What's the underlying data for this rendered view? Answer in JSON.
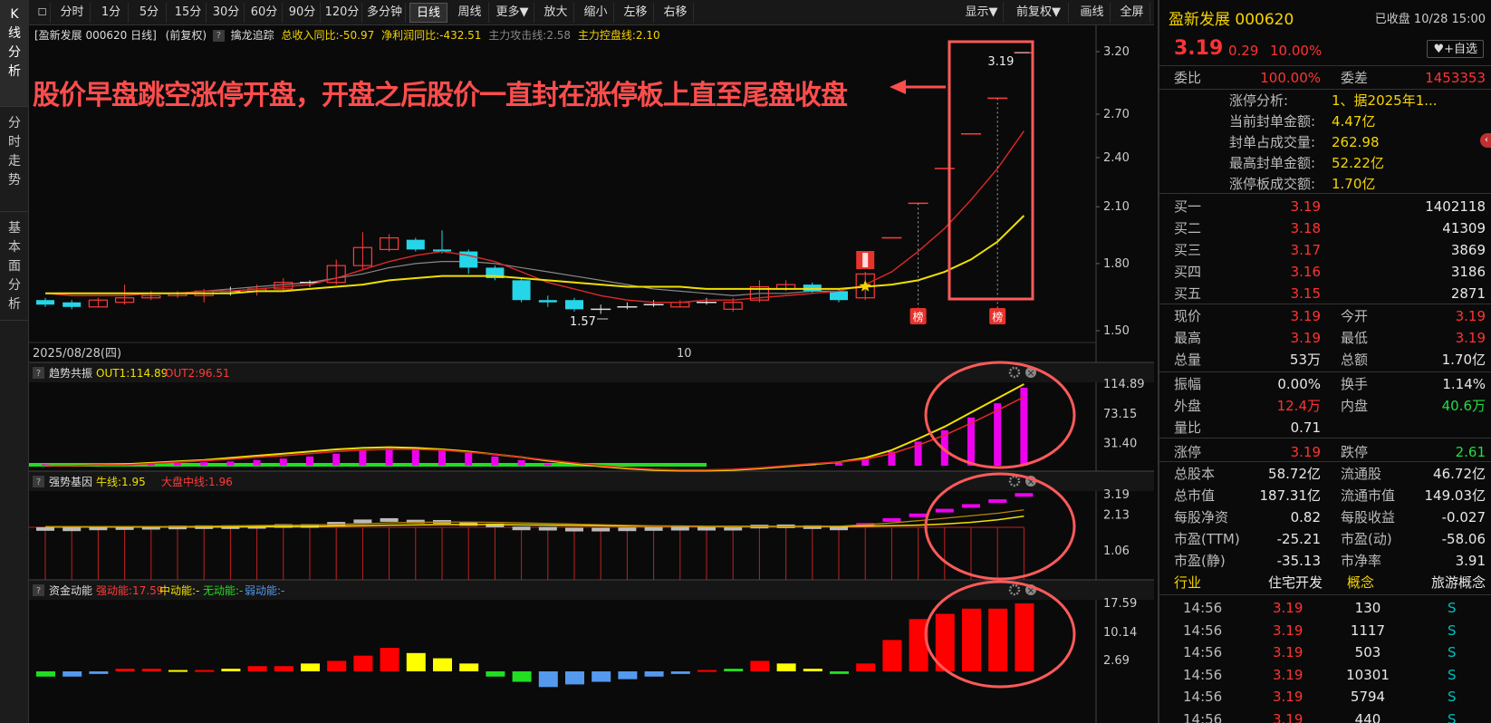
{
  "side_tabs": [
    "K线分析",
    "分时走势",
    "基本面分析"
  ],
  "toolbar": {
    "buttons": [
      "分时",
      "1分",
      "5分",
      "15分",
      "30分",
      "60分",
      "90分",
      "120分",
      "多分钟",
      "日线",
      "周线",
      "更多▼",
      "放大",
      "缩小",
      "左移",
      "右移"
    ],
    "active": "日线",
    "right_buttons": [
      "显示▼",
      "前复权▼",
      "画线",
      "全屏"
    ]
  },
  "infobar": {
    "stock": "[盈新发展 000620 日线]",
    "adjust": "(前复权)",
    "indicator": "擒龙追踪",
    "revenue": "总收入同比:-50.97",
    "profit": "净利润同比:-432.51",
    "attack": "主力攻击线:2.58",
    "control": "主力控盘线:2.10"
  },
  "annotation": {
    "text": "股价早盘跳空涨停开盘，开盘之后股价一直封在涨停板上直至尾盘收盘",
    "color": "#ff4d4d"
  },
  "price_chart": {
    "y_ticks": [
      "3.20",
      "2.70",
      "2.40",
      "2.10",
      "1.80",
      "1.50"
    ],
    "high_label": "3.19",
    "low_label": "1.57",
    "date_label": "2025/08/28(四)",
    "month_label": "10",
    "badge": "榜",
    "candles": [
      {
        "o": 1.63,
        "c": 1.61,
        "h": 1.64,
        "l": 1.6
      },
      {
        "o": 1.62,
        "c": 1.6,
        "h": 1.63,
        "l": 1.59
      },
      {
        "o": 1.6,
        "c": 1.63,
        "h": 1.64,
        "l": 1.6
      },
      {
        "o": 1.62,
        "c": 1.64,
        "h": 1.7,
        "l": 1.61
      },
      {
        "o": 1.64,
        "c": 1.65,
        "h": 1.67,
        "l": 1.63
      },
      {
        "o": 1.65,
        "c": 1.66,
        "h": 1.67,
        "l": 1.64
      },
      {
        "o": 1.65,
        "c": 1.67,
        "h": 1.68,
        "l": 1.62
      },
      {
        "o": 1.67,
        "c": 1.67,
        "h": 1.69,
        "l": 1.65
      },
      {
        "o": 1.67,
        "c": 1.68,
        "h": 1.7,
        "l": 1.65
      },
      {
        "o": 1.68,
        "c": 1.71,
        "h": 1.73,
        "l": 1.67
      },
      {
        "o": 1.71,
        "c": 1.71,
        "h": 1.72,
        "l": 1.69
      },
      {
        "o": 1.71,
        "c": 1.79,
        "h": 1.82,
        "l": 1.7
      },
      {
        "o": 1.79,
        "c": 1.88,
        "h": 1.96,
        "l": 1.77
      },
      {
        "o": 1.87,
        "c": 1.93,
        "h": 1.95,
        "l": 1.86
      },
      {
        "o": 1.92,
        "c": 1.87,
        "h": 1.93,
        "l": 1.86
      },
      {
        "o": 1.87,
        "c": 1.86,
        "h": 1.97,
        "l": 1.85
      },
      {
        "o": 1.86,
        "c": 1.78,
        "h": 1.87,
        "l": 1.75
      },
      {
        "o": 1.78,
        "c": 1.73,
        "h": 1.79,
        "l": 1.72
      },
      {
        "o": 1.72,
        "c": 1.63,
        "h": 1.73,
        "l": 1.62
      },
      {
        "o": 1.63,
        "c": 1.62,
        "h": 1.65,
        "l": 1.6
      },
      {
        "o": 1.63,
        "c": 1.59,
        "h": 1.64,
        "l": 1.58
      },
      {
        "o": 1.59,
        "c": 1.59,
        "h": 1.61,
        "l": 1.57
      },
      {
        "o": 1.6,
        "c": 1.6,
        "h": 1.62,
        "l": 1.59
      },
      {
        "o": 1.61,
        "c": 1.61,
        "h": 1.63,
        "l": 1.6
      },
      {
        "o": 1.6,
        "c": 1.62,
        "h": 1.63,
        "l": 1.6
      },
      {
        "o": 1.62,
        "c": 1.62,
        "h": 1.64,
        "l": 1.61
      },
      {
        "o": 1.59,
        "c": 1.62,
        "h": 1.64,
        "l": 1.58
      },
      {
        "o": 1.63,
        "c": 1.69,
        "h": 1.72,
        "l": 1.62
      },
      {
        "o": 1.68,
        "c": 1.7,
        "h": 1.72,
        "l": 1.67
      },
      {
        "o": 1.7,
        "c": 1.67,
        "h": 1.71,
        "l": 1.66
      },
      {
        "o": 1.67,
        "c": 1.63,
        "h": 1.68,
        "l": 1.62
      },
      {
        "o": 1.64,
        "c": 1.75,
        "h": 1.76,
        "l": 1.63
      },
      {
        "o": 1.93,
        "c": 1.93,
        "h": 1.93,
        "l": 1.93
      },
      {
        "o": 2.12,
        "c": 2.12,
        "h": 2.12,
        "l": 2.12
      },
      {
        "o": 2.33,
        "c": 2.33,
        "h": 2.33,
        "l": 2.33
      },
      {
        "o": 2.56,
        "c": 2.56,
        "h": 2.56,
        "l": 2.56
      },
      {
        "o": 2.82,
        "c": 2.82,
        "h": 2.82,
        "l": 2.82
      },
      {
        "o": 3.19,
        "c": 3.19,
        "h": 3.19,
        "l": 3.19
      }
    ],
    "ma_yellow": [
      1.66,
      1.66,
      1.66,
      1.66,
      1.66,
      1.66,
      1.66,
      1.66,
      1.67,
      1.67,
      1.68,
      1.69,
      1.7,
      1.72,
      1.73,
      1.74,
      1.74,
      1.74,
      1.73,
      1.72,
      1.71,
      1.7,
      1.69,
      1.69,
      1.69,
      1.68,
      1.68,
      1.68,
      1.68,
      1.68,
      1.68,
      1.69,
      1.7,
      1.72,
      1.76,
      1.82,
      1.91,
      2.05
    ],
    "ma_red": [
      1.66,
      1.65,
      1.65,
      1.65,
      1.66,
      1.66,
      1.67,
      1.67,
      1.68,
      1.69,
      1.7,
      1.73,
      1.77,
      1.81,
      1.84,
      1.86,
      1.84,
      1.81,
      1.76,
      1.71,
      1.68,
      1.65,
      1.63,
      1.62,
      1.62,
      1.63,
      1.63,
      1.64,
      1.65,
      1.66,
      1.67,
      1.7,
      1.76,
      1.86,
      1.98,
      2.14,
      2.33,
      2.58
    ],
    "ma_gray": [
      1.66,
      1.66,
      1.66,
      1.66,
      1.66,
      1.66,
      1.67,
      1.68,
      1.69,
      1.7,
      1.71,
      1.73,
      1.75,
      1.78,
      1.8,
      1.81,
      1.81,
      1.8,
      1.78,
      1.76,
      1.74,
      1.72,
      1.7,
      1.68,
      1.67,
      1.66,
      1.65,
      1.66,
      1.66,
      1.67,
      1.67
    ]
  },
  "panel1": {
    "name": "趋势共振",
    "out1": "OUT1:114.89",
    "out2": "OUT2:96.51",
    "ticks": [
      "114.89",
      "73.15",
      "31.40"
    ],
    "bars": [
      2,
      1,
      2,
      2,
      3,
      4,
      5,
      6,
      8,
      10,
      13,
      17,
      21,
      24,
      24,
      22,
      18,
      13,
      8,
      3,
      -2,
      -5,
      -8,
      -9,
      -10,
      -10,
      -9,
      -7,
      -3,
      1,
      4,
      9,
      20,
      34,
      50,
      68,
      88,
      110
    ],
    "line_yellow": [
      0,
      0,
      1,
      2,
      4,
      6,
      8,
      11,
      14,
      17,
      20,
      23,
      25,
      26,
      25,
      23,
      20,
      16,
      12,
      7,
      3,
      -1,
      -4,
      -6,
      -7,
      -7,
      -6,
      -4,
      -1,
      2,
      5,
      11,
      22,
      38,
      55,
      75,
      95,
      115
    ],
    "line_red": [
      0,
      0,
      1,
      1,
      3,
      5,
      7,
      9,
      12,
      14,
      17,
      20,
      22,
      23,
      23,
      22,
      19,
      16,
      12,
      8,
      4,
      0,
      -3,
      -5,
      -6,
      -6,
      -5,
      -3,
      0,
      3,
      5,
      9,
      17,
      29,
      43,
      60,
      78,
      97
    ]
  },
  "panel2": {
    "name": "强势基因",
    "bull": "牛线:1.95",
    "market": "大盘中线:1.96",
    "ticks": [
      "3.19",
      "2.13",
      "1.06"
    ]
  },
  "panel3": {
    "name": "资金动能",
    "strong": "强动能:17.59",
    "mid": "中动能:-",
    "none": "无动能:-",
    "weak": "弱动能:-",
    "ticks": [
      "17.59",
      "10.14",
      "2.69"
    ],
    "bars": [
      -2,
      -2,
      -1,
      1,
      1,
      0.5,
      0.5,
      1,
      2,
      2,
      3,
      4,
      6,
      9,
      7,
      5,
      3,
      -2,
      -4,
      -6,
      -5,
      -4,
      -3,
      -2,
      -1,
      0.5,
      1,
      4,
      3,
      1,
      -1,
      3,
      12,
      20,
      22,
      24,
      24,
      26
    ],
    "bar_colors": [
      "#22dd22",
      "#5599ee",
      "#5599ee",
      "#ff0000",
      "#ff0000",
      "#ffff00",
      "#ff0000",
      "#ffff00",
      "#ff0000",
      "#ff0000",
      "#ffff00",
      "#ff0000",
      "#ff0000",
      "#ff0000",
      "#ffff00",
      "#ffff00",
      "#ffff00",
      "#22dd22",
      "#22dd22",
      "#5599ee",
      "#5599ee",
      "#5599ee",
      "#5599ee",
      "#5599ee",
      "#5599ee",
      "#ff0000",
      "#22dd22",
      "#ff0000",
      "#ffff00",
      "#ffff00",
      "#22dd22",
      "#ff0000",
      "#ff0000",
      "#ff0000",
      "#ff0000",
      "#ff0000",
      "#ff0000",
      "#ff0000"
    ]
  },
  "quote": {
    "name": "盈新发展 000620",
    "status": "已收盘 10/28 15:00",
    "price": "3.19",
    "change": "0.29",
    "pct": "10.00%",
    "add_btn": "♥+自选",
    "weibi_label": "委比",
    "weibi": "100.00%",
    "weicha_label": "委差",
    "weicha": "1453353",
    "limit_info": [
      {
        "k": "涨停分析:",
        "v": "1、据2025年1..."
      },
      {
        "k": "当前封单金额:",
        "v": "4.47亿"
      },
      {
        "k": "封单占成交量:",
        "v": "262.98"
      },
      {
        "k": "最高封单金额:",
        "v": "52.22亿"
      },
      {
        "k": "涨停板成交额:",
        "v": "1.70亿"
      }
    ],
    "bids": [
      {
        "k": "买一",
        "p": "3.19",
        "v": "1402118"
      },
      {
        "k": "买二",
        "p": "3.18",
        "v": "41309"
      },
      {
        "k": "买三",
        "p": "3.17",
        "v": "3869"
      },
      {
        "k": "买四",
        "p": "3.16",
        "v": "3186"
      },
      {
        "k": "买五",
        "p": "3.15",
        "v": "2871"
      }
    ],
    "stats1": [
      {
        "k1": "现价",
        "v1": "3.19",
        "k2": "今开",
        "v2": "3.19"
      },
      {
        "k1": "最高",
        "v1": "3.19",
        "k2": "最低",
        "v2": "3.19"
      },
      {
        "k1": "总量",
        "v1": "53万",
        "k2": "总额",
        "v2": "1.70亿"
      }
    ],
    "stats2": [
      {
        "k1": "振幅",
        "v1": "0.00%",
        "k2": "换手",
        "v2": "1.14%"
      },
      {
        "k1": "外盘",
        "v1": "12.4万",
        "k2": "内盘",
        "v2": "40.6万"
      },
      {
        "k1": "量比",
        "v1": "0.71",
        "k2": "",
        "v2": ""
      }
    ],
    "limit_up_label": "涨停",
    "limit_up": "3.19",
    "limit_down_label": "跌停",
    "limit_down": "2.61",
    "stats3": [
      {
        "k1": "总股本",
        "v1": "58.72亿",
        "k2": "流通股",
        "v2": "46.72亿"
      },
      {
        "k1": "总市值",
        "v1": "187.31亿",
        "k2": "流通市值",
        "v2": "149.03亿"
      },
      {
        "k1": "每股净资",
        "v1": "0.82",
        "k2": "每股收益",
        "v2": "-0.027"
      },
      {
        "k1": "市盈(TTM)",
        "v1": "-25.21",
        "k2": "市盈(动)",
        "v2": "-58.06"
      },
      {
        "k1": "市盈(静)",
        "v1": "-35.13",
        "k2": "市净率",
        "v2": "3.91"
      }
    ],
    "industry_label": "行业",
    "industry": "住宅开发",
    "concept_label": "概念",
    "concept": "旅游概念",
    "ticks": [
      {
        "t": "14:56",
        "p": "3.19",
        "v": "130",
        "s": "S"
      },
      {
        "t": "14:56",
        "p": "3.19",
        "v": "1117",
        "s": "S"
      },
      {
        "t": "14:56",
        "p": "3.19",
        "v": "503",
        "s": "S"
      },
      {
        "t": "14:56",
        "p": "3.19",
        "v": "10301",
        "s": "S"
      },
      {
        "t": "14:56",
        "p": "3.19",
        "v": "5794",
        "s": "S"
      },
      {
        "t": "14:56",
        "p": "3.19",
        "v": "440",
        "s": "S"
      }
    ]
  }
}
